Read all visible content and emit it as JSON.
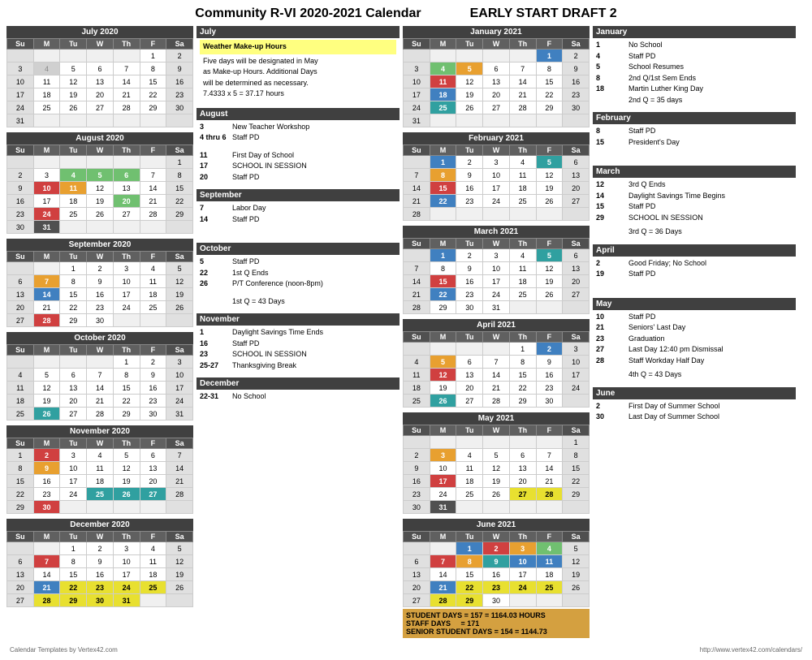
{
  "title": "Community R-VI 2020-2021 Calendar",
  "subtitle": "EARLY START DRAFT 2",
  "footer_left": "Calendar Templates by Vertex42.com",
  "footer_right": "http://www.vertex42.com/calendars/",
  "months": {
    "july2020": {
      "label": "July 2020"
    },
    "aug2020": {
      "label": "August 2020"
    },
    "sep2020": {
      "label": "September 2020"
    },
    "oct2020": {
      "label": "October 2020"
    },
    "nov2020": {
      "label": "November 2020"
    },
    "dec2020": {
      "label": "December 2020"
    },
    "jan2021": {
      "label": "January 2021"
    },
    "feb2021": {
      "label": "February 2021"
    },
    "mar2021": {
      "label": "March 2021"
    },
    "apr2021": {
      "label": "April 2021"
    },
    "may2021": {
      "label": "May 2021"
    },
    "jun2021": {
      "label": "June 2021"
    }
  },
  "notes_headers": {
    "july": "July",
    "august": "August",
    "september": "September",
    "october": "October",
    "november": "November",
    "december": "December",
    "january": "January",
    "february": "February",
    "march": "March",
    "april": "April",
    "may": "May",
    "june": "June"
  },
  "totals": "STUDENT DAYS = 157 = 1164.03 HOURS\nSTAFF DAYS    = 171\nSENIOR STUDENT DAYS = 154 = 1144.73"
}
